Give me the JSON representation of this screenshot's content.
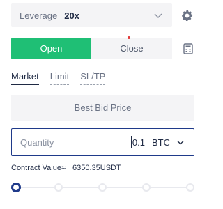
{
  "leverage": {
    "label": "Leverage",
    "value": "20x"
  },
  "actions": {
    "open_label": "Open",
    "close_label": "Close",
    "close_has_notification": true
  },
  "tabs": [
    {
      "label": "Market",
      "active": true
    },
    {
      "label": "Limit",
      "active": false
    },
    {
      "label": "SL/TP",
      "active": false
    }
  ],
  "price_field": {
    "label": "Best Bid Price"
  },
  "quantity": {
    "placeholder": "Quantity",
    "value": "0.1",
    "unit": "BTC"
  },
  "contract_value": {
    "label": "Contract Value≈",
    "value": "6350.35USDT"
  },
  "slider": {
    "stops": 5,
    "value_percent": 0
  },
  "colors": {
    "open": "#1fbf75",
    "accent": "#1f3a8a",
    "notification": "#e23a3a"
  }
}
